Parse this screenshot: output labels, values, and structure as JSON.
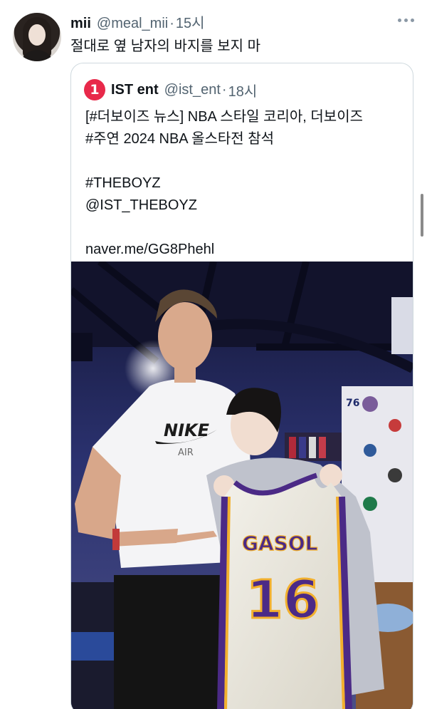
{
  "tweet": {
    "display_name": "mii",
    "handle": "@meal_mii",
    "separator": "·",
    "time": "15시",
    "text": "절대로 옆 남자의 바지를 보지 마"
  },
  "quoted_tweet": {
    "logo_text": "1",
    "display_name": "IST ent",
    "handle": "@ist_ent",
    "separator": "·",
    "time": "18시",
    "text_lines": [
      "[#더보이즈 뉴스] NBA 스타일 코리아, 더보이즈",
      "#주연 2024 NBA 올스타전 참석",
      "",
      "#THEBOYZ",
      "@IST_THEBOYZ",
      "",
      "naver.me/GG8Phehl"
    ],
    "photo": {
      "shirt_brand": "NIKE",
      "shirt_sub": "AIR",
      "jersey_name": "GASOL",
      "jersey_number": "16",
      "sign_number": "76"
    }
  },
  "colors": {
    "text_primary": "#0f1419",
    "text_secondary": "#536471",
    "border": "#cfd9de",
    "logo_red": "#e8294a",
    "lakers_purple": "#4b2a86",
    "lakers_gold": "#f2b02d"
  },
  "icons": {
    "more": "more-horizontal-icon",
    "logo": "ist-logo-icon"
  }
}
